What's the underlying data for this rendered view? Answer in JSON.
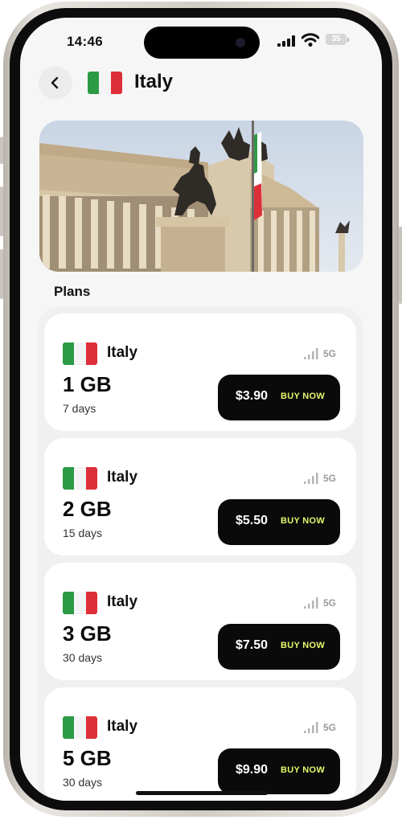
{
  "status_bar": {
    "time": "14:46",
    "battery": "35"
  },
  "header": {
    "title": "Italy",
    "flag_icon": "italy-flag-icon",
    "back_icon": "chevron-left-icon"
  },
  "hero": {
    "image": "Altare della Patria monument in Rome with Italian flag"
  },
  "plans_section": {
    "title": "Plans"
  },
  "plans": [
    {
      "country": "Italy",
      "network": "5G",
      "data": "1 GB",
      "validity": "7 days",
      "price": "$3.90",
      "buy_label": "BUY NOW"
    },
    {
      "country": "Italy",
      "network": "5G",
      "data": "2 GB",
      "validity": "15 days",
      "price": "$5.50",
      "buy_label": "BUY NOW"
    },
    {
      "country": "Italy",
      "network": "5G",
      "data": "3 GB",
      "validity": "30 days",
      "price": "$7.50",
      "buy_label": "BUY NOW"
    },
    {
      "country": "Italy",
      "network": "5G",
      "data": "5 GB",
      "validity": "30 days",
      "price": "$9.90",
      "buy_label": "BUY NOW"
    }
  ],
  "colors": {
    "buy_button_bg": "#0a0a0a",
    "buy_label_accent": "#e6f76a",
    "flag_green": "#2d9a46",
    "flag_white": "#f4f4f4",
    "flag_red": "#dd2f38",
    "card_bg": "#ffffff",
    "list_bg": "#f0f0f0"
  }
}
